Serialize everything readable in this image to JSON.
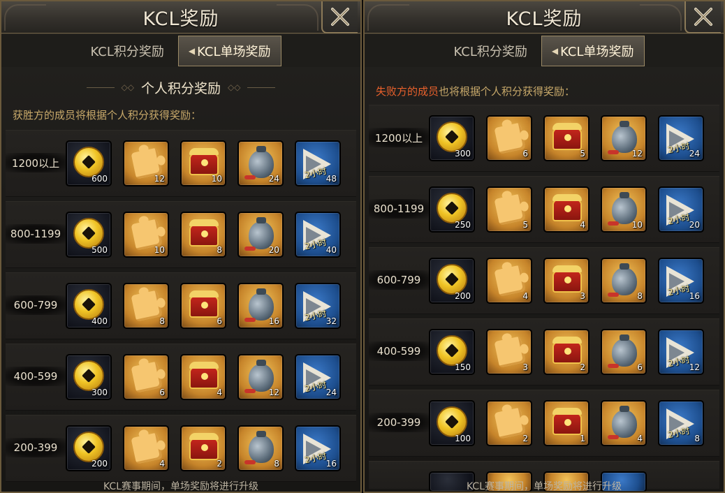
{
  "left_panel": {
    "title": "KCL奖励",
    "tabs": [
      {
        "label": "KCL积分奖励",
        "active": false
      },
      {
        "label": "KCL单场奖励",
        "active": true
      }
    ],
    "subheading": "个人积分奖励",
    "intro": "获胜方的成员将根据个人积分获得奖励：",
    "footer": "KCL赛事期间，单场奖励将进行升级",
    "duration_label": "2小时",
    "tiers": [
      {
        "range": "1200以上",
        "amounts": [
          "600",
          "12",
          "10",
          "24",
          "48"
        ]
      },
      {
        "range": "800-1199",
        "amounts": [
          "500",
          "10",
          "8",
          "20",
          "40"
        ]
      },
      {
        "range": "600-799",
        "amounts": [
          "400",
          "8",
          "6",
          "16",
          "32"
        ]
      },
      {
        "range": "400-599",
        "amounts": [
          "300",
          "6",
          "4",
          "12",
          "24"
        ]
      },
      {
        "range": "200-399",
        "amounts": [
          "200",
          "4",
          "2",
          "8",
          "16"
        ]
      }
    ]
  },
  "right_panel": {
    "title": "KCL奖励",
    "tabs": [
      {
        "label": "KCL积分奖励",
        "active": false
      },
      {
        "label": "KCL单场奖励",
        "active": true
      }
    ],
    "intro_highlight": "失败方的成员",
    "intro_rest": "也将根据个人积分获得奖励：",
    "footer": "KCL赛事期间，单场奖励将进行升级",
    "duration_label": "2小时",
    "tiers": [
      {
        "range": "1200以上",
        "amounts": [
          "300",
          "6",
          "5",
          "12",
          "24"
        ]
      },
      {
        "range": "800-1199",
        "amounts": [
          "250",
          "5",
          "4",
          "10",
          "20"
        ]
      },
      {
        "range": "600-799",
        "amounts": [
          "200",
          "4",
          "3",
          "8",
          "16"
        ]
      },
      {
        "range": "400-599",
        "amounts": [
          "150",
          "3",
          "2",
          "6",
          "12"
        ]
      },
      {
        "range": "200-399",
        "amounts": [
          "100",
          "2",
          "1",
          "4",
          "8"
        ]
      }
    ]
  },
  "reward_icons": [
    "gold-coin-icon",
    "puzzle-piece-icon",
    "treasure-chest-icon",
    "money-bag-icon",
    "exp-flag-icon"
  ],
  "colors": {
    "highlight_red": "#e8612c",
    "intro_gold": "#c8a96a",
    "gold_slot": "#d89a3a",
    "blue_slot": "#1d4e8e"
  }
}
